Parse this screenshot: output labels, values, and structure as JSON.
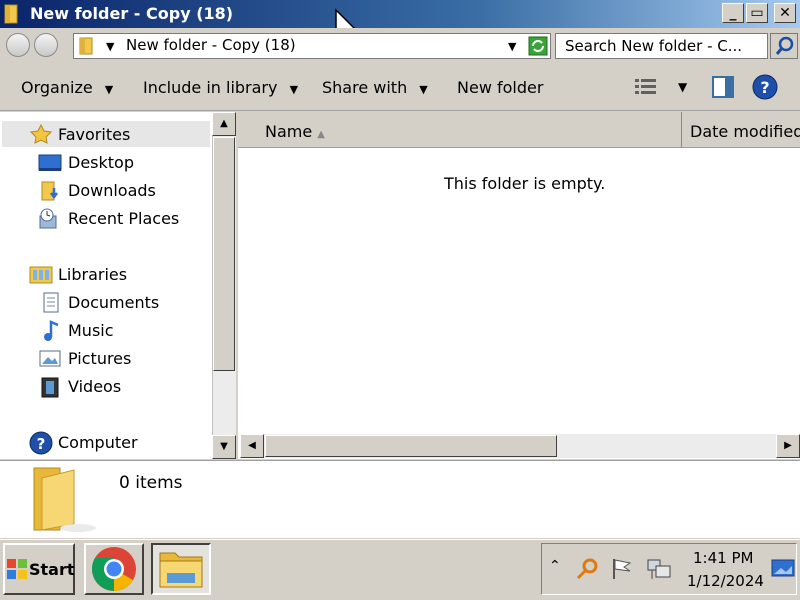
{
  "window": {
    "title": "New folder - Copy (18)",
    "controls": [
      "_",
      "▭",
      "✕"
    ]
  },
  "address": {
    "path": "New folder - Copy (18)",
    "search_placeholder": "Search New folder - C..."
  },
  "toolbar": {
    "organize": "Organize",
    "include_in_library": "Include in library",
    "share_with": "Share with",
    "new_folder": "New folder"
  },
  "nav": {
    "favorites": "Favorites",
    "desktop": "Desktop",
    "downloads": "Downloads",
    "recent_places": "Recent Places",
    "libraries": "Libraries",
    "documents": "Documents",
    "music": "Music",
    "pictures": "Pictures",
    "videos": "Videos",
    "computer": "Computer"
  },
  "columns": {
    "name": "Name",
    "date_modified": "Date modified"
  },
  "content": {
    "empty_message": "This folder is empty."
  },
  "details": {
    "item_count": "0 items"
  },
  "taskbar": {
    "start_label": "Start",
    "time": "1:41 PM",
    "date": "1/12/2024"
  },
  "colors": {
    "title_gradient_start": "#0a246a",
    "title_gradient_end": "#a6caf0",
    "face": "#d4d0c8",
    "folder_yellow": "#f2c94c"
  }
}
